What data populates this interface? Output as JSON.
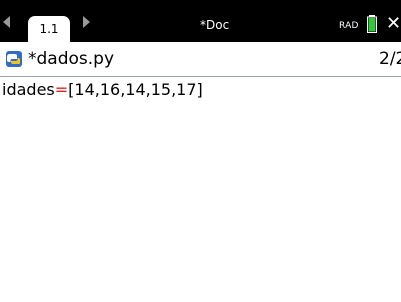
{
  "window": {
    "tab_label": "1.1",
    "doc_title": "*Doc",
    "angle_mode": "RAD"
  },
  "file": {
    "name": "*dados.py",
    "page": "2/2"
  },
  "editor": {
    "line1": {
      "identifier": "idades",
      "operator": "=",
      "value": "[14,16,14,15,17]"
    }
  },
  "colors": {
    "titlebar": "#000000",
    "operator": "#e02020",
    "python_icon_blue": "#2f6ec7",
    "python_icon_yellow": "#f5c518",
    "battery_green": "#35c53f"
  }
}
